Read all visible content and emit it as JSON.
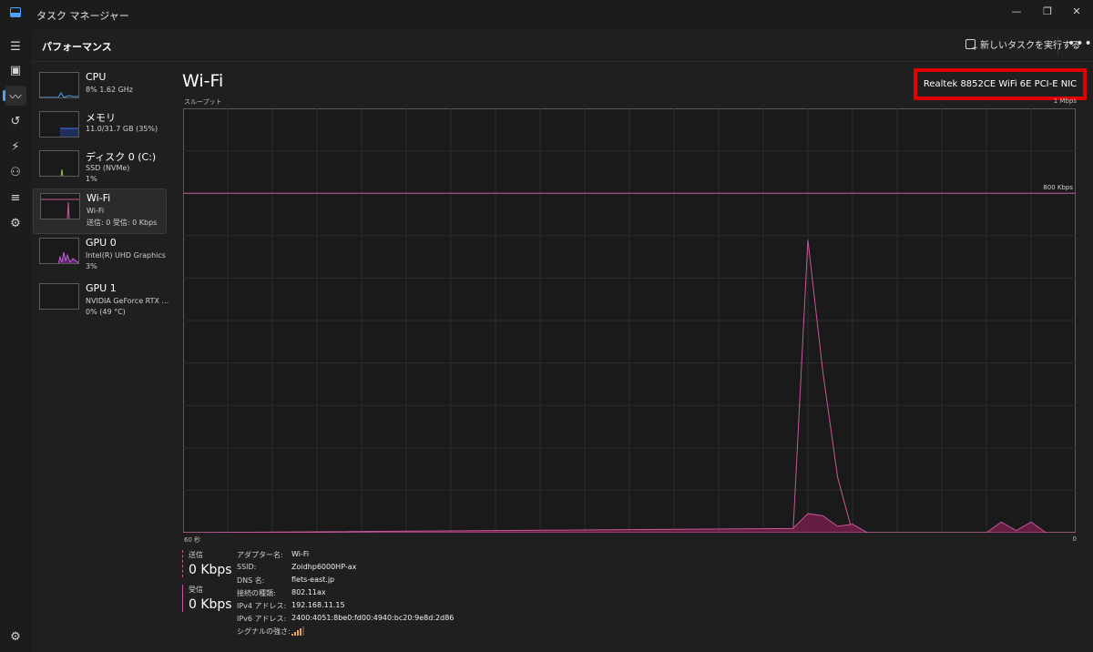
{
  "window": {
    "title": "タスク マネージャー",
    "controls": {
      "minimize": "—",
      "maximize": "❐",
      "close": "✕"
    }
  },
  "header": {
    "page_title": "パフォーマンス",
    "run_task_label": "新しいタスクを実行する",
    "more_label": "•••"
  },
  "rail": {
    "items": [
      {
        "icon": "hamburger-icon"
      },
      {
        "icon": "processes-icon"
      },
      {
        "icon": "performance-icon"
      },
      {
        "icon": "app-history-icon"
      },
      {
        "icon": "startup-icon"
      },
      {
        "icon": "users-icon"
      },
      {
        "icon": "details-icon"
      },
      {
        "icon": "services-icon"
      },
      {
        "icon": "settings-icon"
      }
    ]
  },
  "devices": [
    {
      "name": "CPU",
      "sub1": "8%  1.62 GHz",
      "sub2": "",
      "color": "#4aa3ff"
    },
    {
      "name": "メモリ",
      "sub1": "11.0/31.7 GB (35%)",
      "sub2": "",
      "color": "#4a6fff"
    },
    {
      "name": "ディスク 0 (C:)",
      "sub1": "SSD (NVMe)",
      "sub2": "1%",
      "color": "#8ec63f"
    },
    {
      "name": "Wi-Fi",
      "sub1": "Wi-Fi",
      "sub2": "送信: 0  受信: 0 Kbps",
      "color": "#c8589a"
    },
    {
      "name": "GPU 0",
      "sub1": "Intel(R) UHD Graphics",
      "sub2": "3%",
      "color": "#c65bd6"
    },
    {
      "name": "GPU 1",
      "sub1": "NVIDIA GeForce RTX ...",
      "sub2": "0%  (49 °C)",
      "color": "#c65bd6"
    }
  ],
  "content": {
    "title": "Wi-Fi",
    "adapter": "Realtek 8852CE WiFi 6E PCI-E NIC",
    "throughput_label": "スループット",
    "max_label": "1 Mbps",
    "line_label": "800 Kbps",
    "x_left": "60 秒",
    "x_right": "0"
  },
  "chart_data": {
    "type": "area",
    "title": "",
    "ylabel": "スループット",
    "xlabel": "",
    "ylim": [
      0,
      1000
    ],
    "y_unit": "Kbps",
    "reference_line": 800,
    "x": [
      60,
      19,
      18,
      17,
      16,
      15,
      14,
      13,
      12,
      11,
      10,
      9,
      8,
      7,
      6,
      5,
      4,
      3,
      2,
      1,
      0
    ],
    "series": [
      {
        "values": [
          0,
          0,
          690,
          380,
          130,
          0,
          0,
          0,
          0,
          0,
          0,
          0,
          0,
          0,
          0,
          0,
          0,
          0,
          0,
          0,
          0
        ]
      },
      {
        "values": [
          0,
          10,
          45,
          40,
          15,
          20,
          0,
          0,
          0,
          0,
          0,
          0,
          0,
          0,
          0,
          25,
          5,
          25,
          0,
          0,
          0
        ]
      }
    ],
    "grid": true
  },
  "stats": {
    "send_label": "送信",
    "send_value": "0 Kbps",
    "recv_label": "受信",
    "recv_value": "0 Kbps"
  },
  "properties": [
    {
      "key": "アダプター名:",
      "value": "Wi-Fi"
    },
    {
      "key": "SSID:",
      "value": "Zoidhp6000HP-ax"
    },
    {
      "key": "DNS 名:",
      "value": "flets-east.jp"
    },
    {
      "key": "接続の種類:",
      "value": "802.11ax"
    },
    {
      "key": "IPv4 アドレス:",
      "value": "192.168.11.15"
    },
    {
      "key": "IPv6 アドレス:",
      "value": "2400:4051:8be0:fd00:4940:bc20:9e8d:2d86"
    },
    {
      "key": "シグナルの強さ:",
      "value": ""
    }
  ],
  "signal_bars": 4
}
